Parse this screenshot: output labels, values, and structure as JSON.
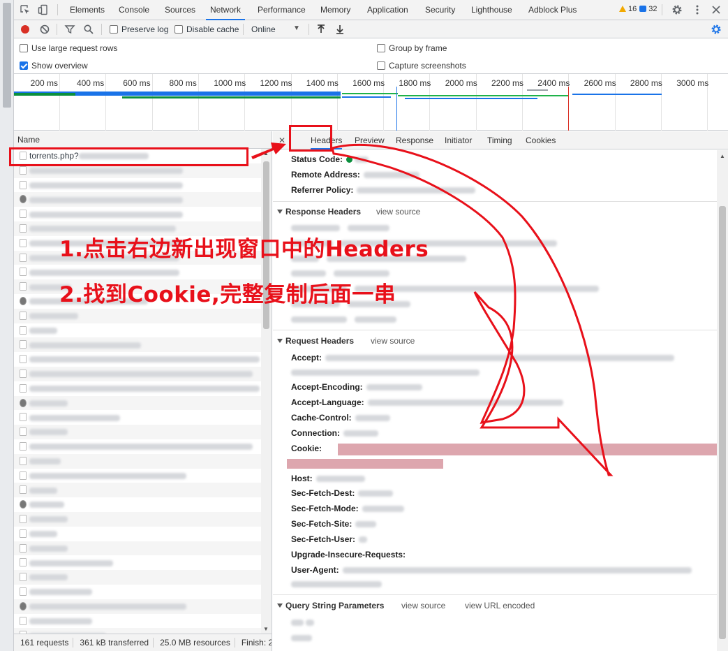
{
  "tabs": [
    "Elements",
    "Console",
    "Sources",
    "Network",
    "Performance",
    "Memory",
    "Application",
    "Security",
    "Lighthouse",
    "Adblock Plus"
  ],
  "active_tab": "Network",
  "badges": {
    "warnings": "16",
    "messages": "32"
  },
  "toolbar": {
    "preserve_log": "Preserve log",
    "disable_cache": "Disable cache",
    "throttle": "Online"
  },
  "settings": {
    "large_rows": "Use large request rows",
    "group_by_frame": "Group by frame",
    "show_overview": "Show overview",
    "capture_screenshots": "Capture screenshots"
  },
  "timeline_ticks": [
    "200 ms",
    "400 ms",
    "600 ms",
    "800 ms",
    "1000 ms",
    "1200 ms",
    "1400 ms",
    "1600 ms",
    "1800 ms",
    "2000 ms",
    "2200 ms",
    "2400 ms",
    "2600 ms",
    "2800 ms",
    "3000 ms"
  ],
  "request_list": {
    "name_header": "Name",
    "first_request": "torrents.php?"
  },
  "status": {
    "requests": "161 requests",
    "transferred": "361 kB transferred",
    "resources": "25.0 MB resources",
    "finish": "Finish: 2"
  },
  "detail_tabs": [
    "Headers",
    "Preview",
    "Response",
    "Initiator",
    "Timing",
    "Cookies"
  ],
  "general": [
    "Status Code:",
    "Remote Address:",
    "Referrer Policy:"
  ],
  "response_headers": {
    "title": "Response Headers",
    "view_source": "view source"
  },
  "request_headers": {
    "title": "Request Headers",
    "view_source": "view source",
    "fields": [
      "Accept:",
      "Accept-Encoding:",
      "Accept-Language:",
      "Cache-Control:",
      "Connection:",
      "Cookie:",
      "Host:",
      "Sec-Fetch-Dest:",
      "Sec-Fetch-Mode:",
      "Sec-Fetch-Site:",
      "Sec-Fetch-User:",
      "Upgrade-Insecure-Requests:",
      "User-Agent:"
    ]
  },
  "query_params": {
    "title": "Query String Parameters",
    "view_source": "view source",
    "view_url_encoded": "view URL encoded"
  },
  "annotations": {
    "step1": "1.点击右边新出现窗口中的Headers",
    "step2": "2.找到Cookie,完整复制后面一串"
  },
  "colors": {
    "accent": "#1a73e8",
    "annotation_red": "#e8101a",
    "cookie_highlight": "#dda6ae"
  }
}
